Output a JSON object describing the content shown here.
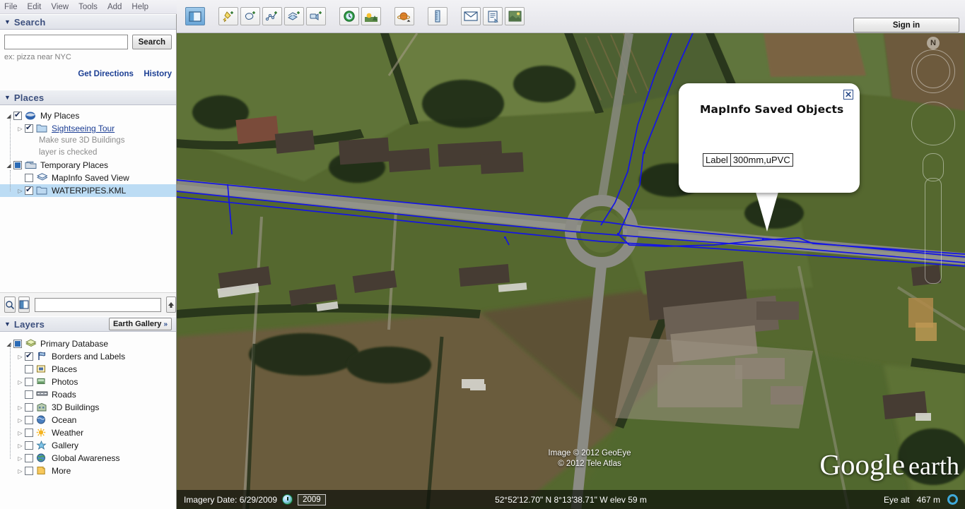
{
  "menu": {
    "items": [
      "File",
      "Edit",
      "View",
      "Tools",
      "Add",
      "Help"
    ]
  },
  "toolbar": {
    "tools": [
      {
        "name": "show-hide-sidebar",
        "label": "Show/Hide Sidebar"
      },
      {
        "name": "add-placemark",
        "label": "Add Placemark"
      },
      {
        "name": "add-polygon",
        "label": "Add Polygon"
      },
      {
        "name": "add-path",
        "label": "Add Path"
      },
      {
        "name": "add-image-overlay",
        "label": "Add Image Overlay"
      },
      {
        "name": "record-tour",
        "label": "Record a Tour"
      },
      {
        "name": "historical-imagery",
        "label": "Show Historical Imagery"
      },
      {
        "name": "sunlight",
        "label": "Show Sunlight Across the Landscape"
      },
      {
        "name": "switch-planet",
        "label": "Switch between Earth, Sky and other planets"
      },
      {
        "name": "ruler",
        "label": "Show Ruler"
      },
      {
        "name": "email",
        "label": "Email"
      },
      {
        "name": "print",
        "label": "Print"
      },
      {
        "name": "save-image",
        "label": "Save Image"
      }
    ],
    "sign_in_label": "Sign in"
  },
  "search": {
    "panel_title": "Search",
    "input_value": "",
    "input_placeholder": "",
    "search_button": "Search",
    "hint": "ex: pizza near NYC",
    "get_directions": "Get Directions",
    "history": "History"
  },
  "places": {
    "panel_title": "Places",
    "tree": [
      {
        "label": "My Places",
        "checkbox": "checked",
        "icon": "earth-icon",
        "arrow": "down",
        "indent": 0,
        "style": "normal",
        "selected": false
      },
      {
        "label": "Sightseeing Tour",
        "checkbox": "checked",
        "icon": "folder-icon",
        "arrow": "right",
        "indent": 1,
        "style": "link",
        "selected": false
      },
      {
        "label": "Temporary Places",
        "checkbox": "partial",
        "icon": "temp-folder-icon",
        "arrow": "down",
        "indent": 0,
        "style": "normal",
        "selected": false
      },
      {
        "label": "MapInfo Saved View",
        "checkbox": "unchecked",
        "icon": "layers-icon",
        "arrow": "none",
        "indent": 1,
        "style": "normal",
        "selected": false
      },
      {
        "label": "WATERPIPES.KML",
        "checkbox": "checked",
        "icon": "folder-icon",
        "arrow": "right",
        "indent": 1,
        "style": "normal",
        "selected": true
      }
    ],
    "description_lines": [
      "Make sure 3D Buildings",
      "layer is checked"
    ],
    "tools": {
      "search_icon": "magnifier-icon",
      "view_icon": "split-view-icon",
      "field_value": "",
      "move_up": "up-arrow-icon",
      "move_down": "down-arrow-icon",
      "folder": "new-folder-icon"
    }
  },
  "layers": {
    "panel_title": "Layers",
    "earth_gallery": "Earth Gallery",
    "earth_gallery_chevron": "»",
    "tree": [
      {
        "label": "Primary Database",
        "checkbox": "partial",
        "icon": "database-icon",
        "arrow": "down",
        "indent": 0
      },
      {
        "label": "Borders and Labels",
        "checkbox": "checked",
        "icon": "borders-icon",
        "arrow": "right",
        "indent": 1
      },
      {
        "label": "Places",
        "checkbox": "unchecked",
        "icon": "places-icon",
        "arrow": "none",
        "indent": 1
      },
      {
        "label": "Photos",
        "checkbox": "unchecked",
        "icon": "photos-icon",
        "arrow": "right",
        "indent": 1
      },
      {
        "label": "Roads",
        "checkbox": "unchecked",
        "icon": "roads-icon",
        "arrow": "none",
        "indent": 1
      },
      {
        "label": "3D Buildings",
        "checkbox": "unchecked",
        "icon": "buildings-icon",
        "arrow": "right",
        "indent": 1
      },
      {
        "label": "Ocean",
        "checkbox": "unchecked",
        "icon": "ocean-icon",
        "arrow": "right",
        "indent": 1
      },
      {
        "label": "Weather",
        "checkbox": "unchecked",
        "icon": "weather-icon",
        "arrow": "right",
        "indent": 1
      },
      {
        "label": "Gallery",
        "checkbox": "unchecked",
        "icon": "gallery-icon",
        "arrow": "right",
        "indent": 1
      },
      {
        "label": "Global Awareness",
        "checkbox": "unchecked",
        "icon": "globe-icon",
        "arrow": "right",
        "indent": 1
      },
      {
        "label": "More",
        "checkbox": "unchecked",
        "icon": "more-icon",
        "arrow": "right",
        "indent": 1
      }
    ]
  },
  "balloon": {
    "title": "MapInfo Saved Objects",
    "attribute_name": "Label",
    "attribute_value": "300mm,uPVC",
    "close_icon": "close-icon"
  },
  "map": {
    "compass_north": "N",
    "copyright_lines": [
      "Image © 2012 GeoEye",
      "© 2012 Tele Atlas"
    ],
    "logo_google": "Google",
    "logo_earth": "earth",
    "pipe_color": "#1414e6"
  },
  "status": {
    "imagery_date_label": "Imagery Date: 6/29/2009",
    "imagery_year": "2009",
    "coordinates": "52°52'12.70\" N   8°13'38.71\" W  elev    59 m",
    "eye_alt_label": "Eye alt",
    "eye_alt_value": "467 m"
  }
}
